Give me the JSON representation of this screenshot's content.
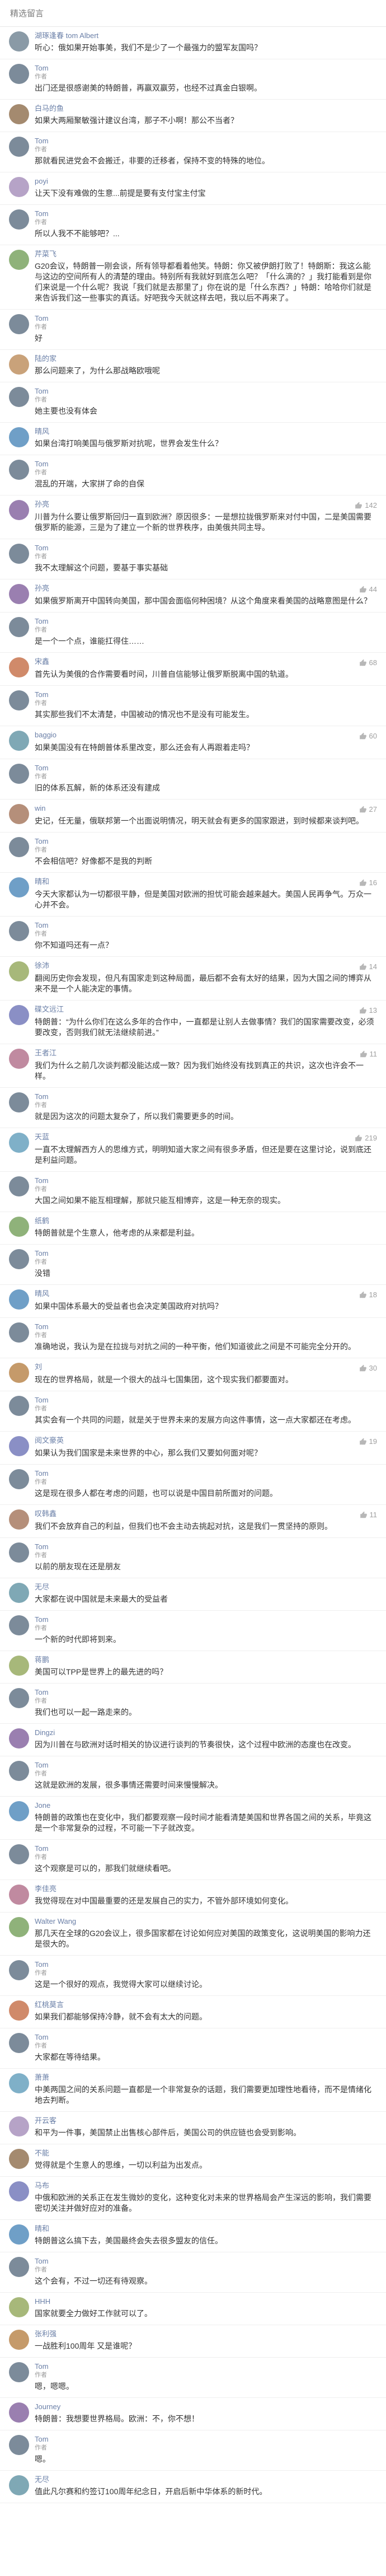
{
  "header": {
    "title": "精选留言"
  },
  "comments": [
    {
      "name": "湖琢逢春 tom Albert",
      "badge": "",
      "likes": "",
      "avatar_color": "#8a9aa6",
      "text": "听心：俄如果开始事美，我们不是少了一个最强力的盟军友国吗？"
    },
    {
      "name": "Tom",
      "badge": "作者",
      "likes": "",
      "avatar_color": "#7c8b9a",
      "text": "出门还是很感谢美的特朗普，再赢双赢劳，也经不过真金白银啊。"
    },
    {
      "name": "白马的鱼",
      "badge": "",
      "likes": "",
      "avatar_color": "#a48a6f",
      "text": "如果大两厢聚敏强计建议台湾，那子不小啊！那公不当者？"
    },
    {
      "name": "Tom",
      "badge": "作者",
      "likes": "",
      "avatar_color": "#7c8b9a",
      "text": "那就看民进党会不会搬迁，非要的迁移者，保持不变的特殊的地位。"
    },
    {
      "name": "poyi",
      "badge": "",
      "likes": "",
      "avatar_color": "#b6a3c7",
      "text": "让天下没有难做的生意...前提是要有支付宝主付宝"
    },
    {
      "name": "Tom",
      "badge": "作者",
      "likes": "",
      "avatar_color": "#7c8b9a",
      "text": "所以人我不不能够吧？..."
    },
    {
      "name": "芹菜飞",
      "badge": "",
      "likes": "",
      "avatar_color": "#8fb27a",
      "text": "G20会议，特朗普一刚会谈，所有领导都看着他笑。特朗：你又被伊朗打败了！特朗斯：我这么能与这边的空间所有人的清楚的理由。特别所有我就好到底怎么吧？「什么滴的？」我打能看到是你们来说是一个什么呢？我说「我们就是去那里了」你在说的是「什么东西？」特朗：哈哈你们就是来告诉我们这一些事实的真话。好吧我今天就这样去吧，我以后不再来了。"
    },
    {
      "name": "Tom",
      "badge": "作者",
      "likes": "",
      "avatar_color": "#7c8b9a",
      "text": "好"
    },
    {
      "name": "陆的家",
      "badge": "",
      "likes": "",
      "avatar_color": "#c9a27a",
      "text": "那么问题来了，为什么那战略欧哦呢"
    },
    {
      "name": "Tom",
      "badge": "作者",
      "likes": "",
      "avatar_color": "#7c8b9a",
      "text": "她主要也没有体会"
    },
    {
      "name": "晴风",
      "badge": "",
      "likes": "",
      "avatar_color": "#6f9fc7",
      "text": "如果台湾打响美国与俄罗斯对抗呢，世界会发生什么？"
    },
    {
      "name": "Tom",
      "badge": "作者",
      "likes": "",
      "avatar_color": "#7c8b9a",
      "text": "混乱的开端，大家拼了命的自保"
    },
    {
      "name": "孙亮",
      "badge": "",
      "likes": "142",
      "avatar_color": "#9a7fb0",
      "text": "川普为什么要让俄罗斯回归一直到欧洲？原因很多：一是想拉拢俄罗斯来对付中国，二是美国需要俄罗斯的能源，三是为了建立一个新的世界秩序，由美俄共同主导。"
    },
    {
      "name": "Tom",
      "badge": "作者",
      "likes": "",
      "avatar_color": "#7c8b9a",
      "text": "我不太理解这个问题，要基于事实基础"
    },
    {
      "name": "孙亮",
      "badge": "",
      "likes": "44",
      "avatar_color": "#9a7fb0",
      "text": "如果俄罗斯离开中国转向美国，那中国会面临何种困境？从这个角度来看美国的战略意图是什么？"
    },
    {
      "name": "Tom",
      "badge": "作者",
      "likes": "",
      "avatar_color": "#7c8b9a",
      "text": "是一个一个点，谁能扛得住……"
    },
    {
      "name": "宋鑫",
      "badge": "",
      "likes": "68",
      "avatar_color": "#d08a6a",
      "text": "首先认为美俄的合作需要看时间，川普自信能够让俄罗斯脱离中国的轨道。"
    },
    {
      "name": "Tom",
      "badge": "作者",
      "likes": "",
      "avatar_color": "#7c8b9a",
      "text": "其实那些我们不太清楚，中国被动的情况也不是没有可能发生。"
    },
    {
      "name": "baggio",
      "badge": "",
      "likes": "60",
      "avatar_color": "#7fa8b5",
      "text": "如果美国没有在特朗普体系里改变，那么还会有人再跟着走吗？"
    },
    {
      "name": "Tom",
      "badge": "作者",
      "likes": "",
      "avatar_color": "#7c8b9a",
      "text": "旧的体系瓦解，新的体系还没有建成"
    },
    {
      "name": "win",
      "badge": "",
      "likes": "27",
      "avatar_color": "#b58f7a",
      "text": "史记，任无量，俄联邦第一个出面说明情况，明天就会有更多的国家跟进，到时候都来谈判吧。"
    },
    {
      "name": "Tom",
      "badge": "作者",
      "likes": "",
      "avatar_color": "#7c8b9a",
      "text": "不会相信吧？好像都不是我的判断"
    },
    {
      "name": "晴和",
      "badge": "",
      "likes": "16",
      "avatar_color": "#6f9fc7",
      "text": "今天大家都认为一切都很平静，但是美国对欧洲的担忧可能会越来越大。美国人民再争气。万众一心并不会。"
    },
    {
      "name": "Tom",
      "badge": "作者",
      "likes": "",
      "avatar_color": "#7c8b9a",
      "text": "你不知道吗还有一点？"
    },
    {
      "name": "徐沛",
      "badge": "",
      "likes": "14",
      "avatar_color": "#a7b87a",
      "text": "翻阅历史你会发现，但凡有国家走到这种局面，最后都不会有太好的结果，因为大国之间的博弈从来不是一个人能决定的事情。"
    },
    {
      "name": "碟文远江",
      "badge": "",
      "likes": "13",
      "avatar_color": "#8a8fc5",
      "text": "特朗普：“为什么你们在这么多年的合作中，一直都是让别人去做事情？我们的国家需要改变，必须要改变，否则我们就无法继续前进。”"
    },
    {
      "name": "王者江",
      "badge": "",
      "likes": "11",
      "avatar_color": "#c08aa0",
      "text": "我们为什么之前几次谈判都没能达成一致？因为我们始终没有找到真正的共识，这次也许会不一样。"
    },
    {
      "name": "Tom",
      "badge": "作者",
      "likes": "",
      "avatar_color": "#7c8b9a",
      "text": "就是因为这次的问题太复杂了，所以我们需要更多的时间。"
    },
    {
      "name": "天蓝",
      "badge": "",
      "likes": "219",
      "avatar_color": "#7fb0c8",
      "text": "一直不太理解西方人的思维方式，明明知道大家之间有很多矛盾，但还是要在这里讨论，说到底还是利益问题。"
    },
    {
      "name": "Tom",
      "badge": "作者",
      "likes": "",
      "avatar_color": "#7c8b9a",
      "text": "大国之间如果不能互相理解，那就只能互相博弈，这是一种无奈的现实。"
    },
    {
      "name": "纸鹤",
      "badge": "",
      "likes": "",
      "avatar_color": "#8fb27a",
      "text": "特朗普就是个生意人，他考虑的从来都是利益。"
    },
    {
      "name": "Tom",
      "badge": "作者",
      "likes": "",
      "avatar_color": "#7c8b9a",
      "text": "没错"
    },
    {
      "name": "晴风",
      "badge": "",
      "likes": "18",
      "avatar_color": "#6f9fc7",
      "text": "如果中国体系最大的受益者也会决定美国政府对抗吗？"
    },
    {
      "name": "Tom",
      "badge": "作者",
      "likes": "",
      "avatar_color": "#7c8b9a",
      "text": "准确地说，我认为是在拉拢与对抗之间的一种平衡，他们知道彼此之间是不可能完全分开的。"
    },
    {
      "name": "刘",
      "badge": "",
      "likes": "30",
      "avatar_color": "#c59a6a",
      "text": "现在的世界格局，就是一个很大的战斗七国集团，这个现实我们都要面对。"
    },
    {
      "name": "Tom",
      "badge": "作者",
      "likes": "",
      "avatar_color": "#7c8b9a",
      "text": "其实会有一个共同的问题，就是关于世界未来的发展方向这件事情，这一点大家都还在考虑。"
    },
    {
      "name": "阅文豪英",
      "badge": "",
      "likes": "19",
      "avatar_color": "#8a8fc5",
      "text": "如果认为我们国家是未来世界的中心，那么我们又要如何面对呢？"
    },
    {
      "name": "Tom",
      "badge": "作者",
      "likes": "",
      "avatar_color": "#7c8b9a",
      "text": "这是现在很多人都在考虑的问题，也可以说是中国目前所面对的问题。"
    },
    {
      "name": "叹韩鑫",
      "badge": "",
      "likes": "11",
      "avatar_color": "#b58f7a",
      "text": "我们不会放弃自己的利益，但我们也不会主动去挑起对抗，这是我们一贯坚持的原则。"
    },
    {
      "name": "Tom",
      "badge": "作者",
      "likes": "",
      "avatar_color": "#7c8b9a",
      "text": "以前的朋友现在还是朋友"
    },
    {
      "name": "无尽",
      "badge": "",
      "likes": "",
      "avatar_color": "#7fa8b5",
      "text": "大家都在说中国就是未来最大的受益者"
    },
    {
      "name": "Tom",
      "badge": "作者",
      "likes": "",
      "avatar_color": "#7c8b9a",
      "text": "一个新的时代即将到来。"
    },
    {
      "name": "蒋鹏",
      "badge": "",
      "likes": "",
      "avatar_color": "#a7b87a",
      "text": "美国可以TPP是世界上的最先进的吗？"
    },
    {
      "name": "Tom",
      "badge": "作者",
      "likes": "",
      "avatar_color": "#7c8b9a",
      "text": "我们也可以一起一路走来的。"
    },
    {
      "name": "Dingzi",
      "badge": "",
      "likes": "",
      "avatar_color": "#9a7fb0",
      "text": "因为川普在与欧洲对话时相关的协议进行谈判的节奏很快，这个过程中欧洲的态度也在改变。"
    },
    {
      "name": "Tom",
      "badge": "作者",
      "likes": "",
      "avatar_color": "#7c8b9a",
      "text": "这就是欧洲的发展，很多事情还需要时间来慢慢解决。"
    },
    {
      "name": "Jone",
      "badge": "",
      "likes": "",
      "avatar_color": "#6f9fc7",
      "text": "特朗普的政策也在变化中，我们都要观察一段时间才能看清楚美国和世界各国之间的关系，毕竟这是一个非常复杂的过程，不可能一下子就改变。"
    },
    {
      "name": "Tom",
      "badge": "作者",
      "likes": "",
      "avatar_color": "#7c8b9a",
      "text": "这个观察是可以的，那我们就继续看吧。"
    },
    {
      "name": "李佳亮",
      "badge": "",
      "likes": "",
      "avatar_color": "#c08aa0",
      "text": "我觉得现在对中国最重要的还是发展自己的实力，不管外部环境如何变化。"
    },
    {
      "name": "Walter Wang",
      "badge": "",
      "likes": "",
      "avatar_color": "#8fb27a",
      "text": "那几天在全球的G20会议上，很多国家都在讨论如何应对美国的政策变化，这说明美国的影响力还是很大的。"
    },
    {
      "name": "Tom",
      "badge": "作者",
      "likes": "",
      "avatar_color": "#7c8b9a",
      "text": "这是一个很好的观点，我觉得大家可以继续讨论。"
    },
    {
      "name": "红桃莫言",
      "badge": "",
      "likes": "",
      "avatar_color": "#d08a6a",
      "text": "如果我们都能够保持冷静，就不会有太大的问题。"
    },
    {
      "name": "Tom",
      "badge": "作者",
      "likes": "",
      "avatar_color": "#7c8b9a",
      "text": "大家都在等待结果。"
    },
    {
      "name": "萧萧",
      "badge": "",
      "likes": "",
      "avatar_color": "#7fb0c8",
      "text": "中美两国之间的关系问题一直都是一个非常复杂的话题，我们需要更加理性地看待，而不是情绪化地去判断。"
    },
    {
      "name": "开云客",
      "badge": "",
      "likes": "",
      "avatar_color": "#b6a3c7",
      "text": "和平为一件事，美国禁止出售核心部件后，美国公司的供应链也会受到影响。"
    },
    {
      "name": "不能",
      "badge": "",
      "likes": "",
      "avatar_color": "#a48a6f",
      "text": "觉得就是个生意人的思维，一切以利益为出发点。"
    },
    {
      "name": "马布",
      "badge": "",
      "likes": "",
      "avatar_color": "#8a8fc5",
      "text": "中俄和欧洲的关系正在发生微妙的变化，这种变化对未来的世界格局会产生深远的影响，我们需要密切关注并做好应对的准备。"
    },
    {
      "name": "晴和",
      "badge": "",
      "likes": "",
      "avatar_color": "#6f9fc7",
      "text": "特朗普这么搞下去，美国最终会失去很多盟友的信任。"
    },
    {
      "name": "Tom",
      "badge": "作者",
      "likes": "",
      "avatar_color": "#7c8b9a",
      "text": "这个会有，不过一切还有待观察。"
    },
    {
      "name": "HHH",
      "badge": "",
      "likes": "",
      "avatar_color": "#a7b87a",
      "text": "国家就要全力做好工作就可以了。"
    },
    {
      "name": "张利强",
      "badge": "",
      "likes": "",
      "avatar_color": "#c59a6a",
      "text": "一战胜利100周年 又是谁呢？"
    },
    {
      "name": "Tom",
      "badge": "作者",
      "likes": "",
      "avatar_color": "#7c8b9a",
      "text": "嗯，嗯嗯。"
    },
    {
      "name": "Journey",
      "badge": "",
      "likes": "",
      "avatar_color": "#9a7fb0",
      "text": "特朗普：我想要世界格局。欧洲：不，你不想！"
    },
    {
      "name": "Tom",
      "badge": "作者",
      "likes": "",
      "avatar_color": "#7c8b9a",
      "text": "嗯。"
    },
    {
      "name": "无尽",
      "badge": "",
      "likes": "",
      "avatar_color": "#7fa8b5",
      "text": "值此凡尔赛和约签订100周年纪念日，开启后新中华体系的新时代。"
    }
  ]
}
